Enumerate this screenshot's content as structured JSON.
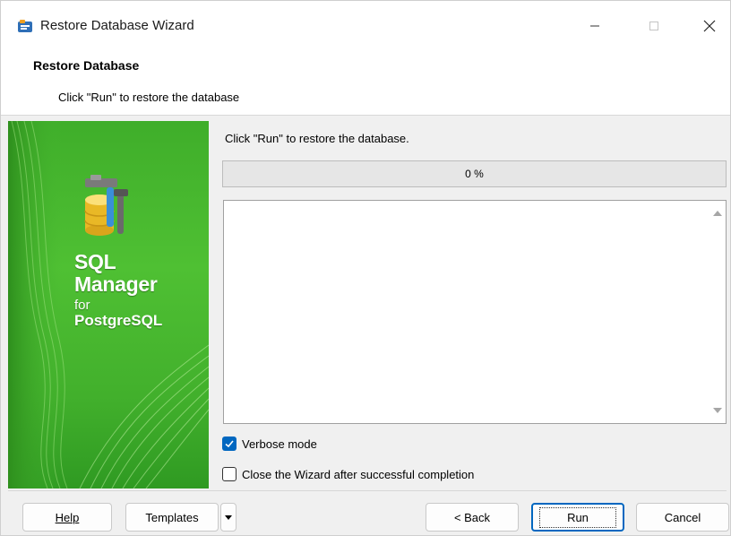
{
  "window": {
    "title": "Restore Database Wizard"
  },
  "header": {
    "title": "Restore Database",
    "subtitle": "Click \"Run\" to restore the database"
  },
  "banner": {
    "line1": "SQL",
    "line2": "Manager",
    "line3": "for",
    "line4": "PostgreSQL",
    "icon": "database-tools-icon"
  },
  "main": {
    "instruction": "Click \"Run\" to restore the database.",
    "progress": {
      "value": 0,
      "label": "0 %"
    },
    "log_text": "",
    "options": [
      {
        "label": "Verbose mode",
        "checked": true
      },
      {
        "label": "Close the Wizard after successful completion",
        "checked": false
      }
    ]
  },
  "footer": {
    "help_label": "Help",
    "templates_label": "Templates",
    "back_label": "< Back",
    "run_label": "Run",
    "cancel_label": "Cancel"
  },
  "colors": {
    "accent": "#0067c0",
    "banner_green": "#4fc033",
    "progress_fill": "#06b025"
  }
}
